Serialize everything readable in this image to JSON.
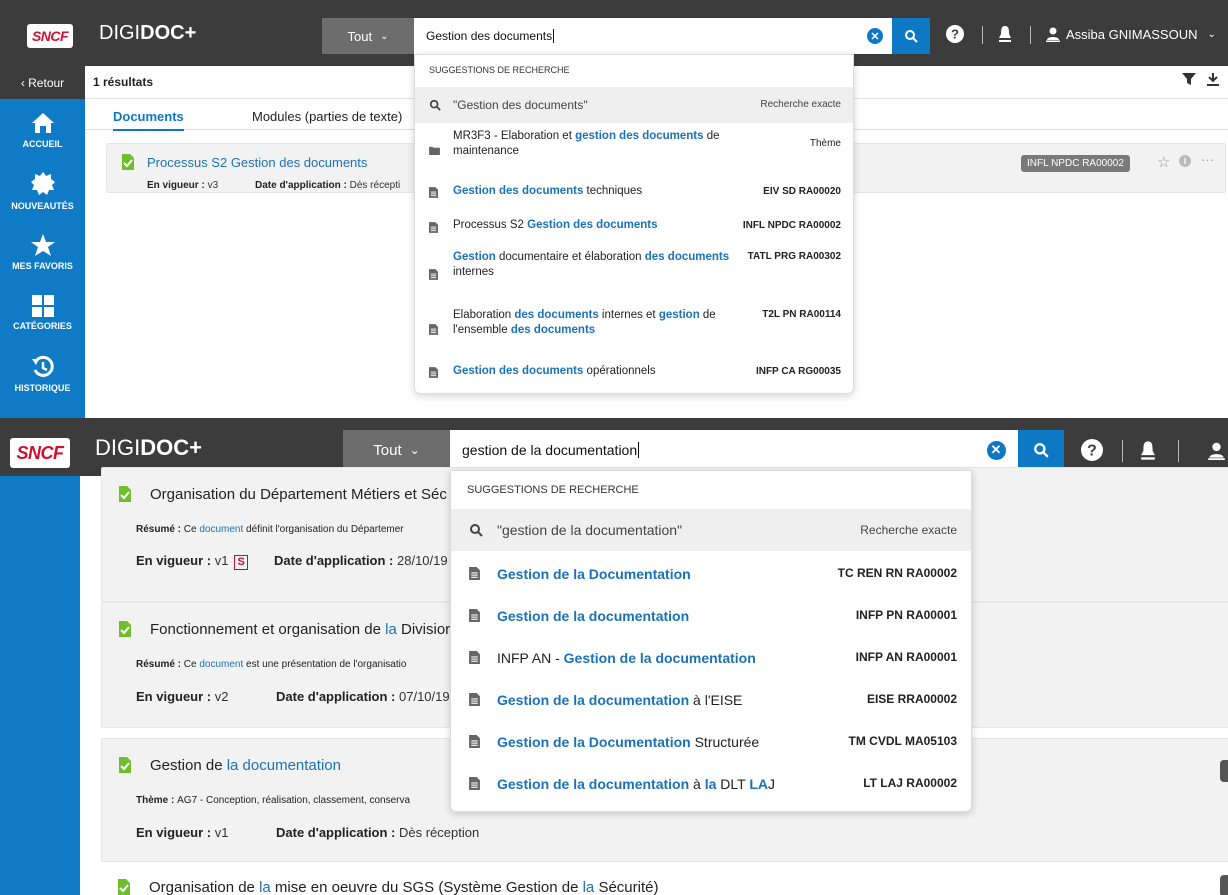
{
  "app": {
    "logo": "SNCF",
    "title_prefix": "DIGI",
    "title_bold": "DOC+"
  },
  "panel1": {
    "scope_label": "Tout",
    "search_value": "Gestion des documents",
    "user_name": "Assiba GNIMASSOUN",
    "back_label": "‹ Retour",
    "nav": [
      {
        "label": "ACCUEIL",
        "icon": "home-icon"
      },
      {
        "label": "NOUVEAUTÉS",
        "icon": "badge-icon"
      },
      {
        "label": "MES FAVORIS",
        "icon": "star-icon"
      },
      {
        "label": "CATÉGORIES",
        "icon": "grid-icon"
      },
      {
        "label": "HISTORIQUE",
        "icon": "history-icon"
      }
    ],
    "results_count": "1 résultats",
    "tabs": [
      "Documents",
      "Modules (parties de texte)"
    ],
    "card": {
      "title": "Processus S2 Gestion des documents",
      "status_label": "En vigueur :",
      "status_value": "v3",
      "date_label": "Date d'application :",
      "date_value": "Dès récepti",
      "tag": "INFL NPDC RA00002"
    },
    "dropdown": {
      "header": "SUGGESTIONS DE RECHERCHE",
      "exact_query": "\"Gestion des documents\"",
      "exact_label": "Recherche exacte",
      "items": [
        {
          "icon": "folder-icon",
          "parts": [
            [
              "MR3F3 - Elaboration et ",
              "p"
            ],
            [
              "gestion des documents",
              "h"
            ],
            [
              " de maintenance",
              "p"
            ]
          ],
          "code": "Thème",
          "code_bold": false
        },
        {
          "icon": "document-icon",
          "parts": [
            [
              "Gestion des documents",
              "h"
            ],
            [
              " techniques",
              "p"
            ]
          ],
          "code": "EIV SD RA00020",
          "code_bold": true
        },
        {
          "icon": "document-icon",
          "parts": [
            [
              "Processus S2 ",
              "p"
            ],
            [
              "Gestion des documents",
              "h"
            ]
          ],
          "code": "INFL NPDC RA00002",
          "code_bold": true
        },
        {
          "icon": "document-icon",
          "parts": [
            [
              "Gestion",
              "h"
            ],
            [
              " documentaire et élaboration ",
              "p"
            ],
            [
              "des documents",
              "h"
            ],
            [
              " internes",
              "p"
            ]
          ],
          "code": "TATL PRG RA00302",
          "code_bold": true
        },
        {
          "icon": "document-icon",
          "parts": [
            [
              "Elaboration ",
              "p"
            ],
            [
              "des documents",
              "h"
            ],
            [
              " internes et ",
              "p"
            ],
            [
              "gestion",
              "h"
            ],
            [
              " de l'ensemble ",
              "p"
            ],
            [
              "des documents",
              "h"
            ]
          ],
          "code": "T2L PN RA00114",
          "code_bold": true
        },
        {
          "icon": "document-icon",
          "parts": [
            [
              "Gestion des documents",
              "h"
            ],
            [
              " opérationnels",
              "p"
            ]
          ],
          "code": "INFP CA RG00035",
          "code_bold": true
        }
      ]
    }
  },
  "panel2": {
    "scope_label": "Tout",
    "search_value": "gestion de la documentation",
    "cards": [
      {
        "title_parts": [
          [
            "Organisation du Département Métiers et Séc",
            "p"
          ]
        ],
        "summary_label": "Résumé :",
        "summary_parts": [
          [
            "Ce ",
            "p"
          ],
          [
            "document",
            "b"
          ],
          [
            " définit l'organisation du Départemer",
            "p"
          ]
        ],
        "status_label": "En vigueur :",
        "status_value": "v1",
        "s_badge": "S",
        "date_label": "Date d'application :",
        "date_value": "28/10/19"
      },
      {
        "title_parts": [
          [
            "Fonctionnement et organisation de ",
            "p"
          ],
          [
            "la",
            "b"
          ],
          [
            " Divisior",
            "p"
          ]
        ],
        "summary_label": "Résumé :",
        "summary_parts": [
          [
            "Ce ",
            "p"
          ],
          [
            "document",
            "b"
          ],
          [
            " est une présentation de l'organisatio",
            "p"
          ]
        ],
        "status_label": "En vigueur :",
        "status_value": "v2",
        "date_label": "Date d'application :",
        "date_value": "07/10/19"
      },
      {
        "title_parts": [
          [
            "Gestion de ",
            "p"
          ],
          [
            "la documentation",
            "b"
          ]
        ],
        "summary_label": "Thème :",
        "summary_parts": [
          [
            "AG7 - Conception, réalisation, classement, conserva",
            "p"
          ]
        ],
        "status_label": "En vigueur :",
        "status_value": "v1",
        "date_label": "Date d'application :",
        "date_value": "Dès réception"
      },
      {
        "title_parts": [
          [
            "Organisation de ",
            "p"
          ],
          [
            "la",
            "b"
          ],
          [
            " mise en oeuvre du SGS (Système Gestion de ",
            "p"
          ],
          [
            "la",
            "b"
          ],
          [
            " Sécurité)",
            "p"
          ]
        ]
      }
    ],
    "dropdown": {
      "header": "SUGGESTIONS DE RECHERCHE",
      "exact_query": "\"gestion de la documentation\"",
      "exact_label": "Recherche exacte",
      "items": [
        {
          "parts": [
            [
              "Gestion de la Documentation",
              "h"
            ]
          ],
          "code": "TC REN RN RA00002"
        },
        {
          "parts": [
            [
              "Gestion de la documentation",
              "h"
            ]
          ],
          "code": "INFP PN RA00001"
        },
        {
          "parts": [
            [
              "INFP AN - ",
              "p"
            ],
            [
              "Gestion de la documentation",
              "h"
            ]
          ],
          "code": "INFP AN RA00001"
        },
        {
          "parts": [
            [
              "Gestion de la documentation",
              "h"
            ],
            [
              " à l'EISE",
              "p"
            ]
          ],
          "code": "EISE RRA00002"
        },
        {
          "parts": [
            [
              "Gestion de la Documentation",
              "h"
            ],
            [
              " Structurée",
              "p"
            ]
          ],
          "code": "TM CVDL MA05103"
        },
        {
          "parts": [
            [
              "Gestion de la documentation",
              "h"
            ],
            [
              " à ",
              "p"
            ],
            [
              "la",
              "h"
            ],
            [
              " DLT ",
              "p"
            ],
            [
              "LA",
              "h"
            ],
            [
              "J",
              "p"
            ]
          ],
          "code": "LT LAJ RA00002"
        }
      ]
    }
  }
}
